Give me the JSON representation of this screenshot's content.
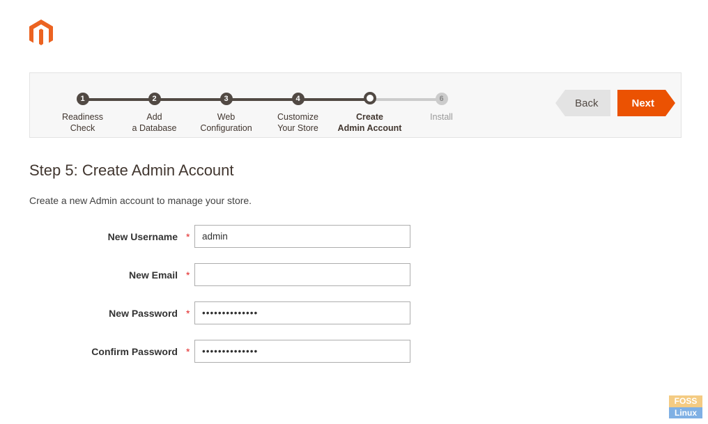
{
  "brand": {
    "color": "#ec6321"
  },
  "steps": [
    {
      "num": "1",
      "label": "Readiness\nCheck",
      "state": "done"
    },
    {
      "num": "2",
      "label": "Add\na Database",
      "state": "done"
    },
    {
      "num": "3",
      "label": "Web\nConfiguration",
      "state": "done"
    },
    {
      "num": "4",
      "label": "Customize\nYour Store",
      "state": "done"
    },
    {
      "num": "",
      "label": "Create\nAdmin Account",
      "state": "current"
    },
    {
      "num": "6",
      "label": "Install",
      "state": "future"
    }
  ],
  "nav": {
    "back": "Back",
    "next": "Next"
  },
  "page": {
    "title": "Step 5: Create Admin Account",
    "desc": "Create a new Admin account to manage your store."
  },
  "form": {
    "username": {
      "label": "New Username",
      "value": "admin",
      "required": "*"
    },
    "email": {
      "label": "New Email",
      "value": "",
      "required": "*"
    },
    "password": {
      "label": "New Password",
      "value": "••••••••••••••",
      "required": "*"
    },
    "confirm": {
      "label": "Confirm Password",
      "value": "••••••••••••••",
      "required": "*"
    }
  },
  "watermark": {
    "top": "FOSS",
    "bottom": "Linux"
  }
}
